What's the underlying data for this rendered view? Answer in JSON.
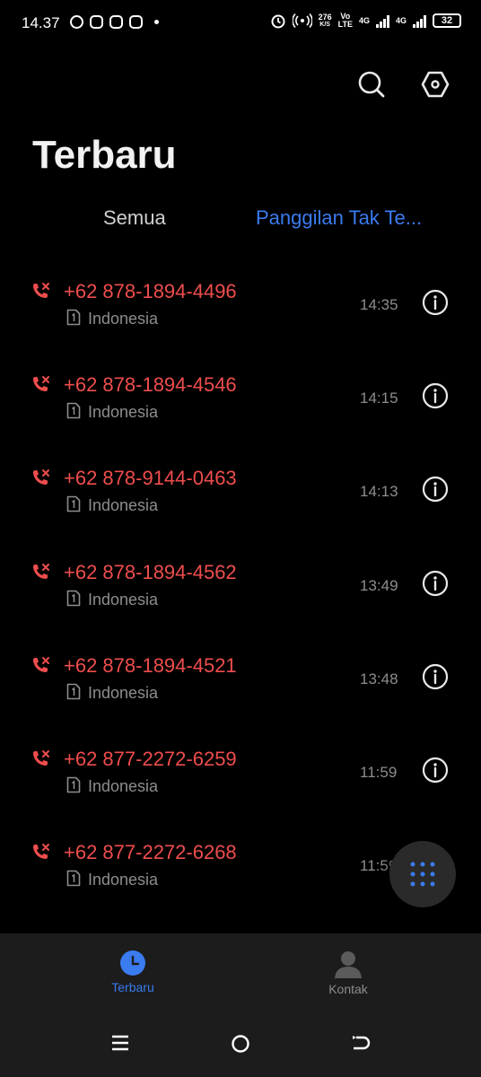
{
  "status_bar": {
    "time": "14.37",
    "net_speed": "276",
    "net_speed_unit": "K/S",
    "volte_top": "Vo",
    "volte_bottom": "LTE",
    "sig1_label": "4G",
    "sig2_label": "4G",
    "battery": "32"
  },
  "header": {
    "title": "Terbaru",
    "search_icon": "search-icon",
    "settings_icon": "settings-icon"
  },
  "tabs": {
    "all": "Semua",
    "missed": "Panggilan Tak Te..."
  },
  "calls": [
    {
      "number": "+62 878-1894-4496",
      "country": "Indonesia",
      "time": "14:35"
    },
    {
      "number": "+62 878-1894-4546",
      "country": "Indonesia",
      "time": "14:15"
    },
    {
      "number": "+62 878-9144-0463",
      "country": "Indonesia",
      "time": "14:13"
    },
    {
      "number": "+62 878-1894-4562",
      "country": "Indonesia",
      "time": "13:49"
    },
    {
      "number": "+62 878-1894-4521",
      "country": "Indonesia",
      "time": "13:48"
    },
    {
      "number": "+62 877-2272-6259",
      "country": "Indonesia",
      "time": "11:59"
    },
    {
      "number": "+62 877-2272-6268",
      "country": "Indonesia",
      "time": "11:59"
    }
  ],
  "bottom_nav": {
    "recent": "Terbaru",
    "contacts": "Kontak"
  },
  "colors": {
    "accent": "#3a7bf0",
    "missed": "#ef4d4d",
    "secondary_text": "#8d8d8d"
  }
}
